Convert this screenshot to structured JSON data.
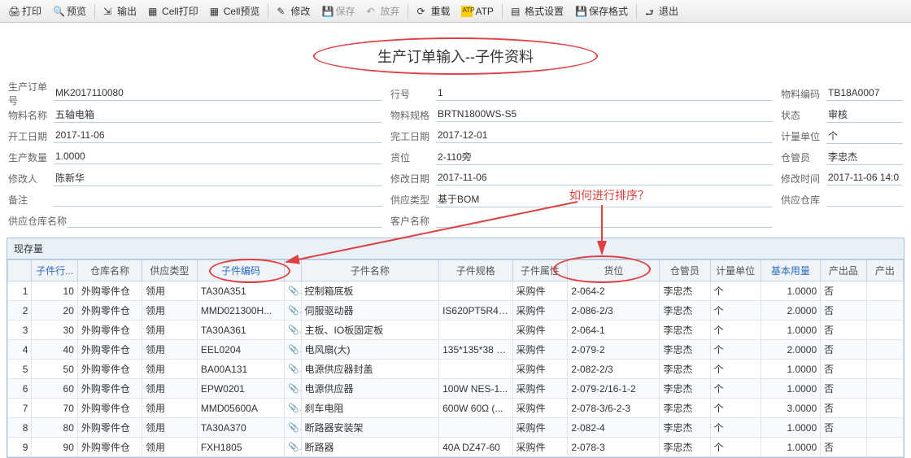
{
  "toolbar": {
    "print": "打印",
    "preview": "预览",
    "output": "输出",
    "cellPrint": "Cell打印",
    "cellPreview": "Cell预览",
    "modify": "修改",
    "save": "保存",
    "revoke": "放弃",
    "reload": "重载",
    "atp": "ATP",
    "formatSet": "格式设置",
    "saveFormat": "保存格式",
    "exit": "退出"
  },
  "title": "生产订单输入--子件资料",
  "annot": {
    "sortQ": "如何进行排序？"
  },
  "labels": {
    "prodOrderNo": "生产订单号",
    "matName": "物料名称",
    "startDate": "开工日期",
    "prodQty": "生产数量",
    "modifier": "修改人",
    "remark": "备注",
    "supplyWhName": "供应仓库名称",
    "lineNo": "行号",
    "matSpec": "物料规格",
    "finishDate": "完工日期",
    "loc": "货位",
    "modifyDate": "修改日期",
    "supplyType": "供应类型",
    "custName": "客户名称",
    "matCode": "物料编码",
    "status": "状态",
    "uom": "计量单位",
    "keeper": "仓管员",
    "modifyTime": "修改时间",
    "supplyWh": "供应仓库"
  },
  "form": {
    "prodOrderNo": "MK2017110080",
    "matName": "五轴电箱",
    "startDate": "2017-11-06",
    "prodQty": "1.0000",
    "modifier": "陈新华",
    "remark": "",
    "supplyWhName": "",
    "lineNo": "1",
    "matSpec": "BRTN1800WS-S5",
    "finishDate": "2017-12-01",
    "loc": "2-110旁",
    "modifyDate": "2017-11-06",
    "supplyType": "基于BOM",
    "custName": "",
    "matCode": "TB18A0007",
    "status": "审核",
    "uom": "个",
    "keeper": "李忠杰",
    "modifyTime": "2017-11-06 14:0",
    "supplyWh": ""
  },
  "gridTab": "现存量",
  "cols": {
    "rowNo": "",
    "childLine": "子件行...",
    "whName": "仓库名称",
    "supplyType": "供应类型",
    "childCode": "子件编码",
    "clip": "",
    "childName": "子件名称",
    "childSpec": "子件规格",
    "childAttr": "子件属性",
    "loc": "货位",
    "keeper": "仓管员",
    "uom": "计量单位",
    "baseQty": "基本用量",
    "output": "产出品",
    "prodOut": "产出"
  },
  "rows": [
    {
      "n": "1",
      "line": "10",
      "wh": "外购零件仓",
      "st": "领用",
      "code": "TA30A351",
      "name": "控制箱底板",
      "spec": "",
      "attr": "采购件",
      "loc": "2-064-2",
      "kp": "李忠杰",
      "uom": "个",
      "qty": "1.0000",
      "out": "否"
    },
    {
      "n": "2",
      "line": "20",
      "wh": "外购零件仓",
      "st": "领用",
      "code": "MMD021300H...",
      "name": "伺服驱动器",
      "spec": "IS620PT5R4I...",
      "attr": "采购件",
      "loc": "2-086-2/3",
      "kp": "李忠杰",
      "uom": "个",
      "qty": "2.0000",
      "out": "否"
    },
    {
      "n": "3",
      "line": "30",
      "wh": "外购零件仓",
      "st": "领用",
      "code": "TA30A361",
      "name": "主板、IO板固定板",
      "spec": "",
      "attr": "采购件",
      "loc": "2-064-1",
      "kp": "李忠杰",
      "uom": "个",
      "qty": "1.0000",
      "out": "否"
    },
    {
      "n": "4",
      "line": "40",
      "wh": "外购零件仓",
      "st": "领用",
      "code": "EEL0204",
      "name": "电风扇(大)",
      "spec": "135*135*38 2...",
      "attr": "采购件",
      "loc": "2-079-2",
      "kp": "李忠杰",
      "uom": "个",
      "qty": "2.0000",
      "out": "否"
    },
    {
      "n": "5",
      "line": "50",
      "wh": "外购零件仓",
      "st": "领用",
      "code": "BA00A131",
      "name": "电源供应器封盖",
      "spec": "",
      "attr": "采购件",
      "loc": "2-082-2/3",
      "kp": "李忠杰",
      "uom": "个",
      "qty": "1.0000",
      "out": "否"
    },
    {
      "n": "6",
      "line": "60",
      "wh": "外购零件仓",
      "st": "领用",
      "code": "EPW0201",
      "name": "电源供应器",
      "spec": "100W NES-1...",
      "attr": "采购件",
      "loc": "2-079-2/16-1-2",
      "kp": "李忠杰",
      "uom": "个",
      "qty": "1.0000",
      "out": "否"
    },
    {
      "n": "7",
      "line": "70",
      "wh": "外购零件仓",
      "st": "领用",
      "code": "MMD05600A",
      "name": "刹车电阻",
      "spec": "600W 60Ω (...",
      "attr": "采购件",
      "loc": "2-078-3/6-2-3",
      "kp": "李忠杰",
      "uom": "个",
      "qty": "3.0000",
      "out": "否"
    },
    {
      "n": "8",
      "line": "80",
      "wh": "外购零件仓",
      "st": "领用",
      "code": "TA30A370",
      "name": "断路器安装架",
      "spec": "",
      "attr": "采购件",
      "loc": "2-082-4",
      "kp": "李忠杰",
      "uom": "个",
      "qty": "1.0000",
      "out": "否"
    },
    {
      "n": "9",
      "line": "90",
      "wh": "外购零件仓",
      "st": "领用",
      "code": "FXH1805",
      "name": "断路器",
      "spec": "40A DZ47-60",
      "attr": "采购件",
      "loc": "2-078-3",
      "kp": "李忠杰",
      "uom": "个",
      "qty": "1.0000",
      "out": "否"
    }
  ]
}
